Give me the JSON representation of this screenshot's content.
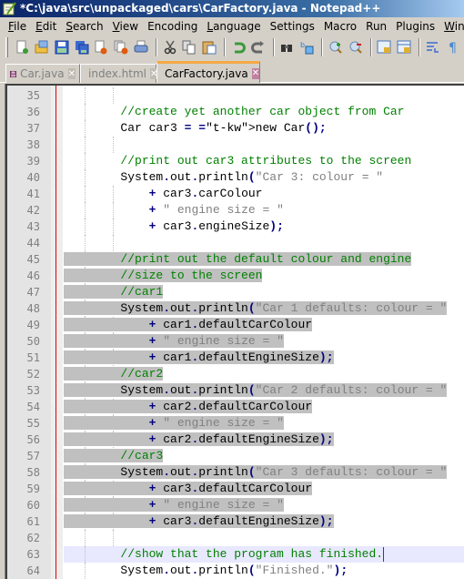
{
  "window": {
    "title": "*C:\\java\\src\\unpackaged\\cars\\CarFactory.java - Notepad++"
  },
  "menu": [
    {
      "label": "File",
      "accel": "F",
      "rest": "ile"
    },
    {
      "label": "Edit",
      "accel": "E",
      "rest": "dit"
    },
    {
      "label": "Search",
      "accel": "S",
      "rest": "earch"
    },
    {
      "label": "View",
      "accel": "V",
      "rest": "iew"
    },
    {
      "label": "Encoding",
      "accel": "",
      "rest": "Encoding"
    },
    {
      "label": "Language",
      "accel": "L",
      "rest": "anguage"
    },
    {
      "label": "Settings",
      "accel": "",
      "rest": "Settings"
    },
    {
      "label": "Macro",
      "accel": "",
      "rest": "Macro"
    },
    {
      "label": "Run",
      "accel": "",
      "rest": "Run"
    },
    {
      "label": "Plugins",
      "accel": "",
      "rest": "Plugins"
    },
    {
      "label": "Window",
      "accel": "W",
      "rest": "indow"
    },
    {
      "label": "?",
      "accel": "?",
      "rest": ""
    }
  ],
  "toolbar": [
    "new-file-icon",
    "open-file-icon",
    "save-icon",
    "save-all-icon",
    "close-icon",
    "close-all-icon",
    "print-icon",
    "|",
    "cut-icon",
    "copy-icon",
    "paste-icon",
    "|",
    "undo-icon",
    "redo-icon",
    "|",
    "find-icon",
    "replace-icon",
    "|",
    "zoom-in-icon",
    "zoom-out-icon",
    "|",
    "sync-vertical-icon",
    "sync-horizontal-icon",
    "|",
    "word-wrap-icon",
    "show-symbols-icon"
  ],
  "tabs": [
    {
      "label": "Car.java",
      "active": false
    },
    {
      "label": "index.html",
      "active": false
    },
    {
      "label": "CarFactory.java",
      "active": true
    }
  ],
  "editor": {
    "first_line": 35,
    "selected_lines": [
      45,
      61
    ],
    "current_line": 63,
    "lines": [
      {
        "n": "35",
        "text": ""
      },
      {
        "n": "36",
        "text": "        //create yet another car object from Car"
      },
      {
        "n": "37",
        "text": "        Car car3 = new Car();"
      },
      {
        "n": "38",
        "text": ""
      },
      {
        "n": "39",
        "text": "        //print out car3 attributes to the screen"
      },
      {
        "n": "40",
        "text": "        System.out.println(\"Car 3: colour = \""
      },
      {
        "n": "41",
        "text": "            + car3.carColour"
      },
      {
        "n": "42",
        "text": "            + \" engine size = \""
      },
      {
        "n": "43",
        "text": "            + car3.engineSize);"
      },
      {
        "n": "44",
        "text": ""
      },
      {
        "n": "45",
        "text": "        //print out the default colour and engine"
      },
      {
        "n": "46",
        "text": "        //size to the screen"
      },
      {
        "n": "47",
        "text": "        //car1"
      },
      {
        "n": "48",
        "text": "        System.out.println(\"Car 1 defaults: colour = \""
      },
      {
        "n": "49",
        "text": "            + car1.defaultCarColour"
      },
      {
        "n": "50",
        "text": "            + \" engine size = \""
      },
      {
        "n": "51",
        "text": "            + car1.defaultEngineSize);"
      },
      {
        "n": "52",
        "text": "        //car2"
      },
      {
        "n": "53",
        "text": "        System.out.println(\"Car 2 defaults: colour = \""
      },
      {
        "n": "54",
        "text": "            + car2.defaultCarColour"
      },
      {
        "n": "55",
        "text": "            + \" engine size = \""
      },
      {
        "n": "56",
        "text": "            + car2.defaultEngineSize);"
      },
      {
        "n": "57",
        "text": "        //car3"
      },
      {
        "n": "58",
        "text": "        System.out.println(\"Car 3 defaults: colour = \""
      },
      {
        "n": "59",
        "text": "            + car3.defaultCarColour"
      },
      {
        "n": "60",
        "text": "            + \" engine size = \""
      },
      {
        "n": "61",
        "text": "            + car3.defaultEngineSize);"
      },
      {
        "n": "62",
        "text": ""
      },
      {
        "n": "63",
        "text": "        //show that the program has finished."
      },
      {
        "n": "64",
        "text": "        System.out.println(\"Finished.\");"
      }
    ]
  },
  "colors": {
    "comment": "#008000",
    "keyword": "#0000ff",
    "operator": "#000080",
    "string": "#808080",
    "selection": "#c0c0c0",
    "current_line": "#e8e8ff",
    "active_tab_accent": "#f5a845",
    "margin_line": "#e00000"
  }
}
